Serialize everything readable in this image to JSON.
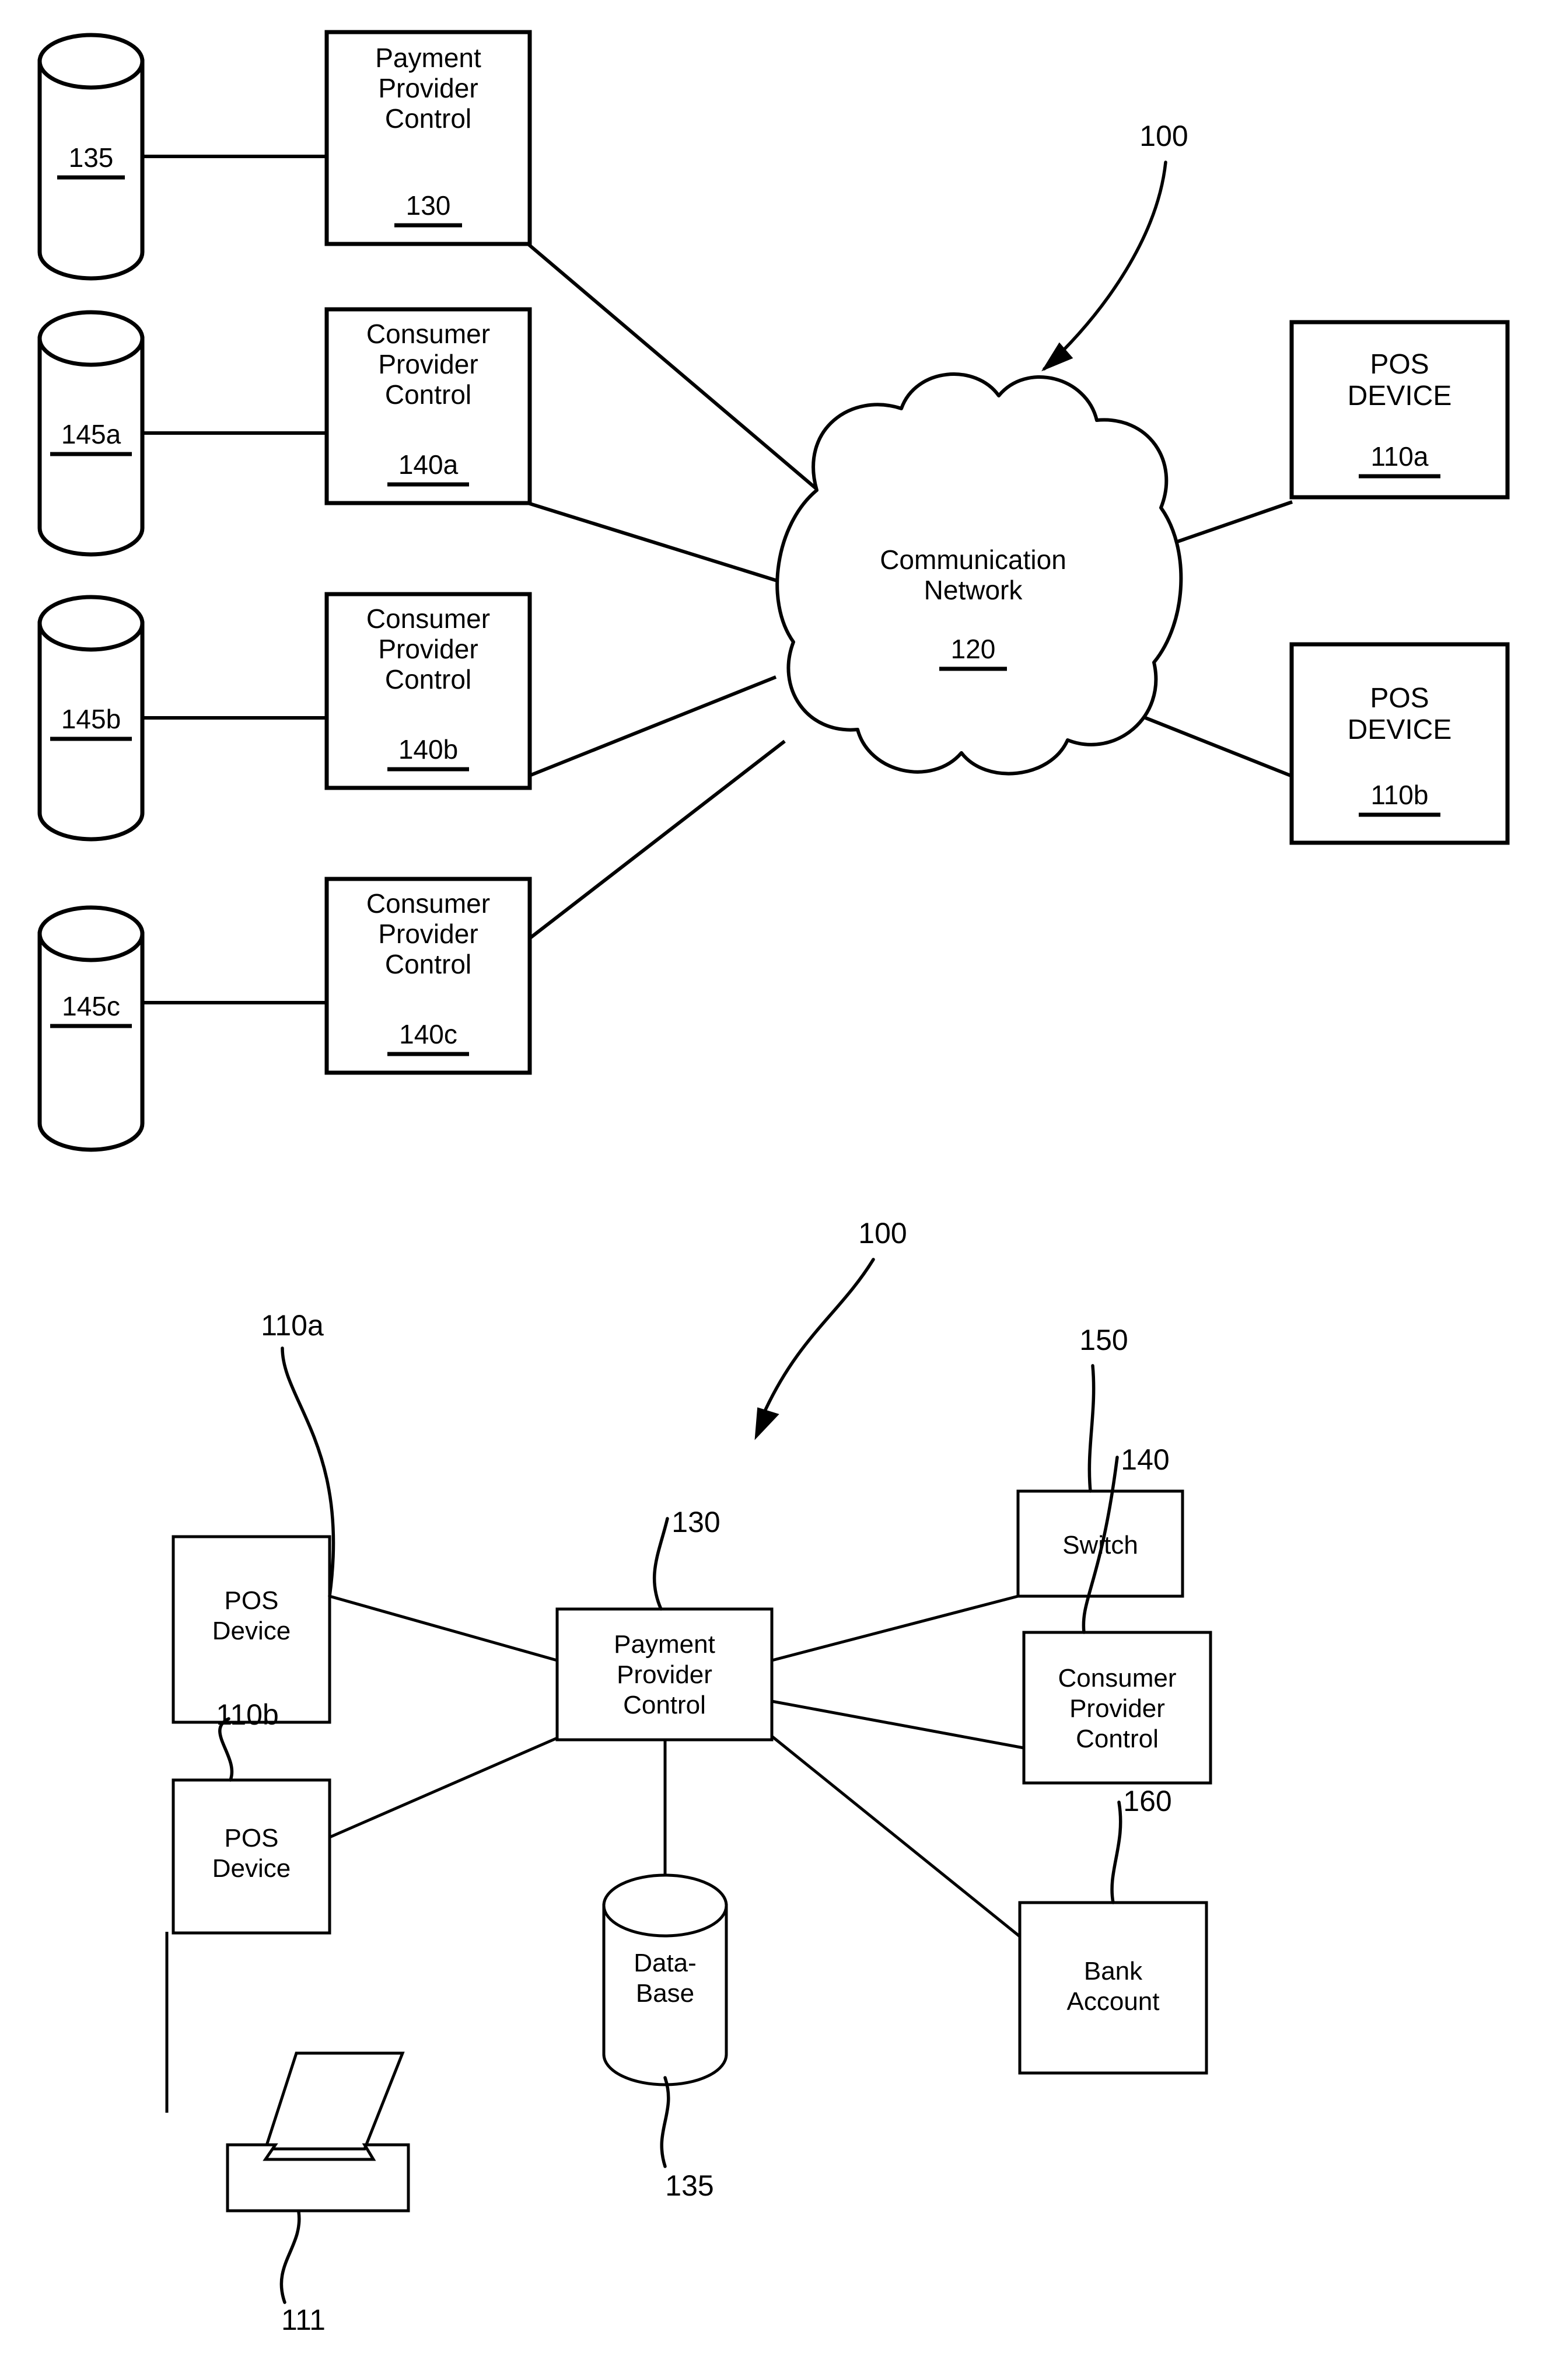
{
  "document": {
    "type": "patent-figure-sheet",
    "figure_count": 2
  },
  "figure_top": {
    "system_ref": "100",
    "nodes": {
      "payment_provider_control": {
        "line1": "Payment",
        "line2": "Provider",
        "line3": "Control",
        "ref": "130"
      },
      "database_135": {
        "ref": "135"
      },
      "consumer_provider_control_a": {
        "line1": "Consumer",
        "line2": "Provider",
        "line3": "Control",
        "ref": "140a"
      },
      "database_145a": {
        "ref": "145a"
      },
      "consumer_provider_control_b": {
        "line1": "Consumer",
        "line2": "Provider",
        "line3": "Control",
        "ref": "140b"
      },
      "database_145b": {
        "ref": "145b"
      },
      "consumer_provider_control_c": {
        "line1": "Consumer",
        "line2": "Provider",
        "line3": "Control",
        "ref": "140c"
      },
      "database_145c": {
        "ref": "145c"
      },
      "communication_network": {
        "line1": "Communication",
        "line2": "Network",
        "ref": "120"
      },
      "pos_device_a": {
        "line1": "POS",
        "line2": "DEVICE",
        "ref": "110a"
      },
      "pos_device_b": {
        "line1": "POS",
        "line2": "DEVICE",
        "ref": "110b"
      }
    }
  },
  "figure_bottom": {
    "system_ref": "100",
    "nodes": {
      "pos_device_a": {
        "line1": "POS",
        "line2": "Device",
        "ref": "110a"
      },
      "pos_device_b": {
        "line1": "POS",
        "line2": "Device",
        "ref": "110b"
      },
      "printer": {
        "ref": "111"
      },
      "payment_provider_control": {
        "line1": "Payment",
        "line2": "Provider",
        "line3": "Control",
        "ref": "130"
      },
      "database": {
        "line1": "Data-",
        "line2": "Base",
        "ref": "135"
      },
      "switch": {
        "line1": "Switch",
        "ref": "150"
      },
      "consumer_provider_control": {
        "line1": "Consumer",
        "line2": "Provider",
        "line3": "Control",
        "ref": "140"
      },
      "bank_account": {
        "line1": "Bank",
        "line2": "Account",
        "ref": "160"
      }
    }
  },
  "colors": {
    "ink": "#000000",
    "paper": "#ffffff"
  }
}
